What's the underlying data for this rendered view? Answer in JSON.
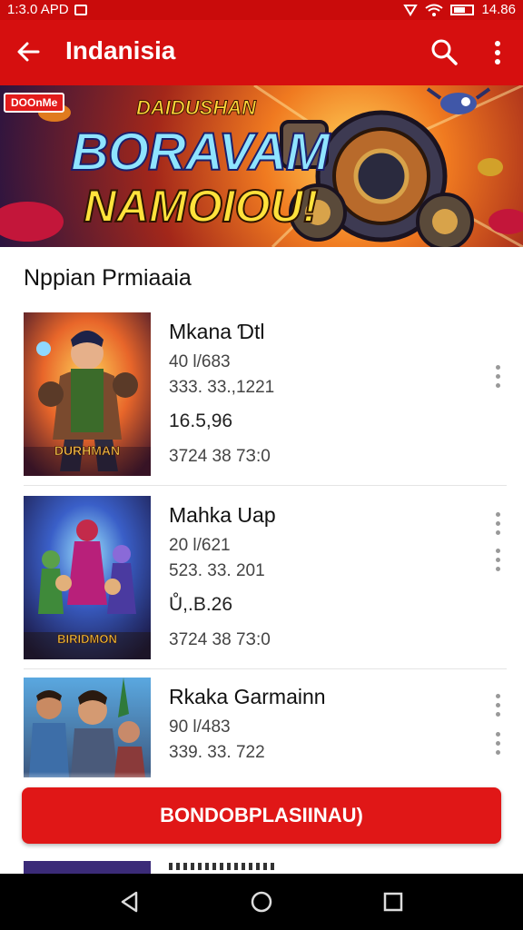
{
  "status_bar": {
    "time": "1:3.0 APD",
    "battery_text": "14.86"
  },
  "app_bar": {
    "title": "Indanisia"
  },
  "banner": {
    "tag": "DOOnMe",
    "line1": "DAIDUSHAN",
    "line2": "BORAVAM",
    "line3": "NAMOIOU!"
  },
  "section": {
    "title": "Nppian Prmiaaia"
  },
  "items": [
    {
      "name": "Mkana Ɗtl",
      "line1": "40 l/683",
      "line2": "333. 33.,1221",
      "line3": "16.5,96",
      "line4": "3724 38 7З:0",
      "thumb_caption": "DURHMAN"
    },
    {
      "name": "Mahka Uap",
      "line1": "20 l/621",
      "line2": "523. 33. 201",
      "line3": "Ů,.B.26",
      "line4": "3724 38 7З:0",
      "thumb_caption": "BIRIDMON"
    },
    {
      "name": "Rkaka Garmainn",
      "line1": "90 l/483",
      "line2": "339. 33. 722",
      "line3": "",
      "line4": "",
      "thumb_caption": ""
    }
  ],
  "cta": {
    "label": "BONDOBPLASIINAU)"
  },
  "colors": {
    "primary": "#d60f0f",
    "status_bar": "#c90b0b",
    "cta": "#e01717"
  },
  "icons": [
    "back-arrow-icon",
    "search-icon",
    "more-vert-icon",
    "nav-back-icon",
    "nav-home-icon",
    "nav-recents-icon"
  ]
}
